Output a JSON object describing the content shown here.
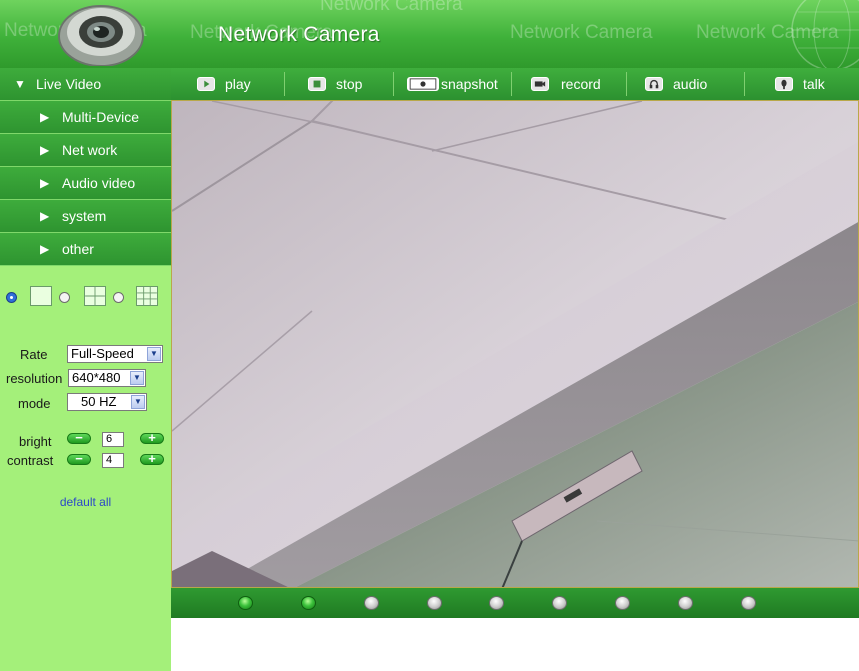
{
  "header": {
    "title": "Network Camera",
    "watermark": "Network Camera"
  },
  "sidebar": {
    "items": [
      {
        "label": "Live Video",
        "arrow": "▼"
      },
      {
        "label": "Multi-Device",
        "arrow": "▶"
      },
      {
        "label": "Net work",
        "arrow": "▶"
      },
      {
        "label": "Audio video",
        "arrow": "▶"
      },
      {
        "label": "system",
        "arrow": "▶"
      },
      {
        "label": "other",
        "arrow": "▶"
      }
    ],
    "layout_options": [
      "single-view",
      "quad-view",
      "nine-view"
    ],
    "layout_selected": "single-view"
  },
  "controls": {
    "rate": {
      "label": "Rate",
      "value": "Full-Speed"
    },
    "resolution": {
      "label": "resolution",
      "value": "640*480"
    },
    "mode": {
      "label": "mode",
      "value": "50 HZ"
    },
    "bright": {
      "label": "bright",
      "value": "6"
    },
    "contrast": {
      "label": "contrast",
      "value": "4"
    },
    "default_all": "default all"
  },
  "toolbar": {
    "buttons": [
      {
        "label": "play",
        "icon": "play-icon"
      },
      {
        "label": "stop",
        "icon": "stop-icon"
      },
      {
        "label": "snapshot",
        "icon": "snapshot-icon"
      },
      {
        "label": "record",
        "icon": "record-icon"
      },
      {
        "label": "audio",
        "icon": "audio-icon"
      },
      {
        "label": "talk",
        "icon": "talk-icon"
      }
    ]
  },
  "video_channels": {
    "count": 9,
    "active": [
      1,
      2
    ]
  },
  "colors": {
    "header_green": "#3fb13a",
    "sidebar_bg": "#a4f07a",
    "nav_green": "#2e9430",
    "link_blue": "#2c49c8"
  }
}
